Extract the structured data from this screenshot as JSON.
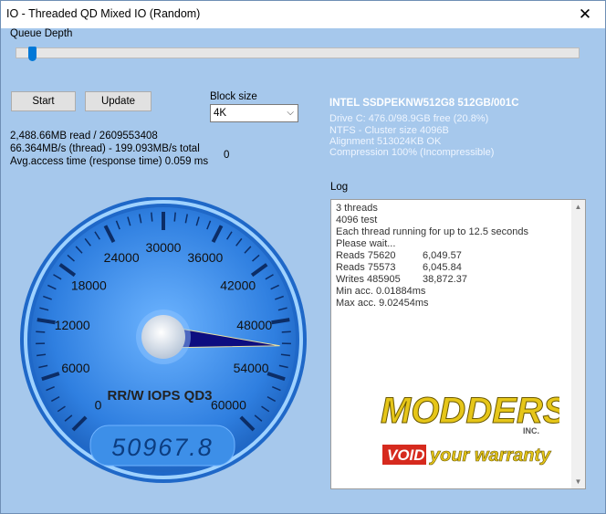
{
  "window": {
    "title": "IO - Threaded QD Mixed IO (Random)",
    "close_glyph": "✕"
  },
  "queue_depth": {
    "label": "Queue Depth",
    "value_fraction": 0.02
  },
  "buttons": {
    "start": "Start",
    "update": "Update"
  },
  "block_size": {
    "label": "Block size",
    "value": "4K"
  },
  "stats": {
    "read": "2,488.66MB read / 2609553408",
    "throughput": "66.364MB/s (thread) - 199.093MB/s total",
    "access": "Avg.access time (response time) 0.059 ms",
    "zero": "0"
  },
  "drive": {
    "model": "INTEL SSDPEKNW512G8 512GB/001C",
    "free": "Drive C: 476.0/98.9GB free (20.8%)",
    "ntfs": "NTFS - Cluster size 4096B",
    "alignment": "Alignment 513024KB OK",
    "compression": "Compression 100% (Incompressible)"
  },
  "log": {
    "label": "Log",
    "lines": [
      "3 threads",
      "4096 test",
      "Each thread running for up to 12.5 seconds",
      "Please wait...",
      "Reads 75620",
      "Reads 75573",
      "Writes 485905",
      "Min acc. 0.01884ms",
      "Max acc. 9.02454ms"
    ],
    "values": [
      "",
      "",
      "",
      "",
      "6,049.57",
      "6,045.84",
      "38,872.37",
      "",
      ""
    ]
  },
  "gauge": {
    "title": "RR/W IOPS QD3",
    "readout": "50967.8",
    "value": 50967.8,
    "max": 60000,
    "ticks": [
      "0",
      "6000",
      "12000",
      "18000",
      "24000",
      "30000",
      "36000",
      "42000",
      "48000",
      "54000",
      "60000"
    ]
  },
  "watermark": {
    "line1": "MODDERS",
    "inc": "INC.",
    "void": "VOID",
    "line2": "your warranty"
  },
  "colors": {
    "window_bg": "#a6c8ec",
    "gauge_face": "#2f7fe0",
    "accent": "#0078d7"
  },
  "icons": {
    "close": "close-icon",
    "dropdown": "chevron-down-icon"
  }
}
